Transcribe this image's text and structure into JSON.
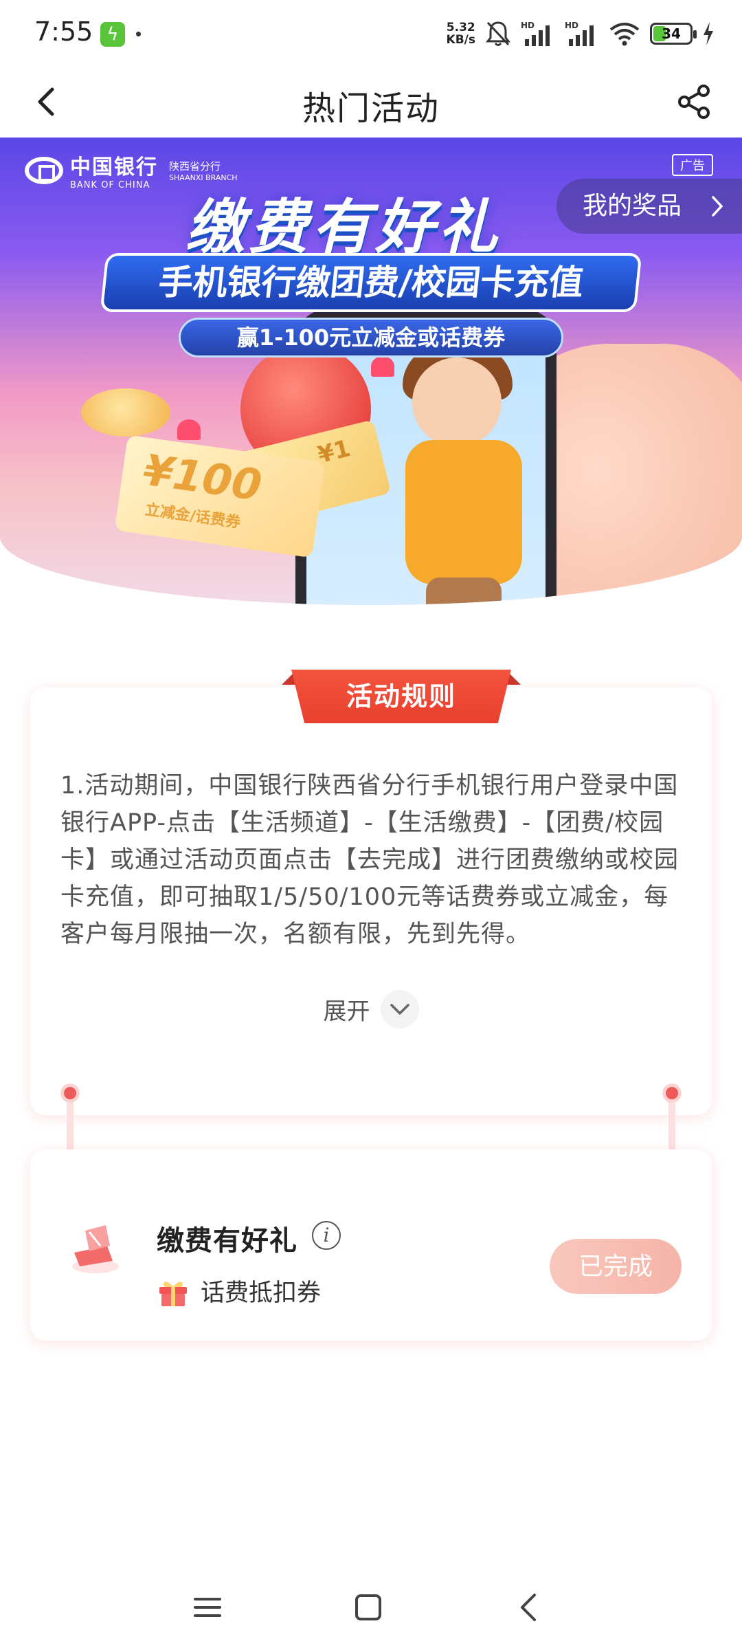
{
  "status_bar": {
    "time": "7:55",
    "net_speed_value": "5.32",
    "net_speed_unit": "KB/s",
    "battery": "34",
    "battery_level": 0.34,
    "icons": [
      "charging-app-icon",
      "mute-bell-icon",
      "signal-hd-icon",
      "signal-hd-icon",
      "wifi-icon",
      "battery-icon",
      "charging-bolt-icon"
    ]
  },
  "nav": {
    "title": "热门活动",
    "back_icon": "chevron-left-icon",
    "share_icon": "share-icon"
  },
  "banner": {
    "bank_name_cn": "中国银行",
    "bank_name_en": "BANK OF CHINA",
    "branch_cn": "陕西省分行",
    "branch_en": "SHAANXI BRANCH",
    "ad_tag": "广告",
    "my_prizes": "我的奖品",
    "headline": "缴费有好礼",
    "subheadline": "手机银行缴团费/校园卡充值",
    "pill": "赢1-100元立减金或话费券",
    "ticket_amount": "¥100",
    "ticket_label": "立减金/话费券",
    "ticket_small_amount": "¥1"
  },
  "rules": {
    "tab_label": "活动规则",
    "text": "1.活动期间，中国银行陕西省分行手机银行用户登录中国银行APP-点击【生活频道】-【生活缴费】-【团费/校园卡】或通过活动页面点击【去完成】进行团费缴纳或校园卡充值，即可抽取1/5/50/100元等话费券或立减金，每客户每月限抽一次，名额有限，先到先得。",
    "expand_label": "展开"
  },
  "task": {
    "title": "缴费有好礼",
    "info_glyph": "i",
    "reward": "话费抵扣券",
    "button_label": "已完成"
  },
  "colors": {
    "accent_red": "#e8402e",
    "done_button": "#f7bdb1",
    "connector_dot": "#ee5a5a"
  }
}
